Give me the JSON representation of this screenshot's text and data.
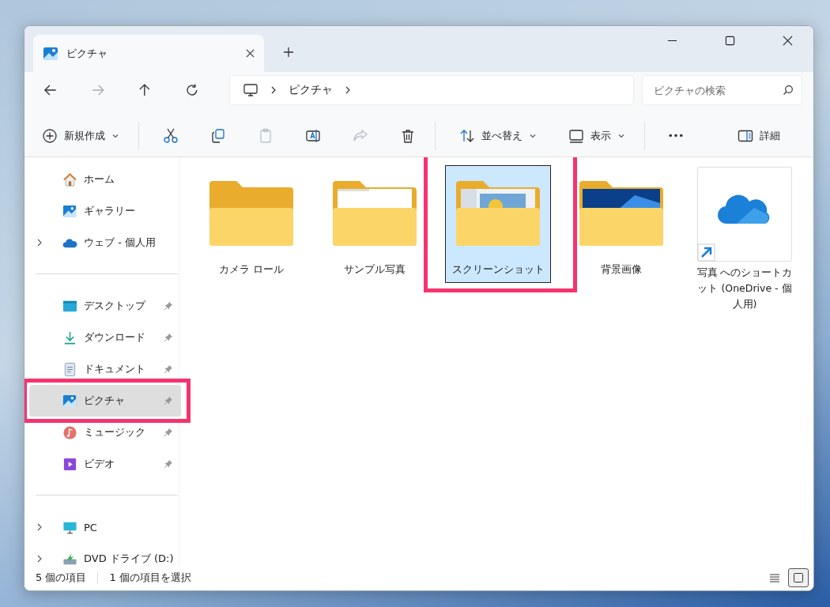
{
  "tab": {
    "title": "ピクチャ",
    "selected": true
  },
  "address": {
    "path": [
      "ピクチャ"
    ]
  },
  "search": {
    "placeholder": "ピクチャの検索"
  },
  "toolbar": [
    {
      "kind": "new",
      "label": "新規作成",
      "dropdown": true,
      "disabled": false
    },
    {
      "kind": "separator"
    },
    {
      "kind": "cut",
      "disabled": false
    },
    {
      "kind": "copy",
      "disabled": false
    },
    {
      "kind": "paste",
      "disabled": true
    },
    {
      "kind": "rename",
      "disabled": false
    },
    {
      "kind": "share",
      "disabled": true
    },
    {
      "kind": "delete",
      "disabled": false
    },
    {
      "kind": "separator"
    },
    {
      "kind": "sort",
      "label": "並べ替え",
      "dropdown": true,
      "disabled": false
    },
    {
      "kind": "view",
      "label": "表示",
      "dropdown": true,
      "disabled": false
    },
    {
      "kind": "separator"
    },
    {
      "kind": "more",
      "disabled": false
    },
    {
      "kind": "spacer"
    },
    {
      "kind": "details",
      "label": "詳細",
      "disabled": false
    }
  ],
  "sidebar": {
    "groups": [
      [
        {
          "label": "ホーム",
          "expandable": false,
          "pinned": false,
          "selected": false,
          "highlighted": false
        },
        {
          "label": "ギャラリー",
          "expandable": false,
          "pinned": false,
          "selected": false,
          "highlighted": false
        },
        {
          "label": "ウェブ - 個人用",
          "expandable": true,
          "pinned": false,
          "selected": false,
          "highlighted": false
        }
      ],
      [
        {
          "label": "デスクトップ",
          "expandable": false,
          "pinned": true,
          "selected": false,
          "highlighted": false
        },
        {
          "label": "ダウンロード",
          "expandable": false,
          "pinned": true,
          "selected": false,
          "highlighted": false
        },
        {
          "label": "ドキュメント",
          "expandable": false,
          "pinned": true,
          "selected": false,
          "highlighted": false
        },
        {
          "label": "ピクチャ",
          "expandable": false,
          "pinned": true,
          "selected": true,
          "highlighted": true
        },
        {
          "label": "ミュージック",
          "expandable": false,
          "pinned": true,
          "selected": false,
          "highlighted": false
        },
        {
          "label": "ビデオ",
          "expandable": false,
          "pinned": true,
          "selected": false,
          "highlighted": false
        }
      ],
      [
        {
          "label": "PC",
          "expandable": true,
          "pinned": false,
          "selected": false,
          "highlighted": false
        },
        {
          "label": "DVD ドライブ (D:)",
          "expandable": true,
          "pinned": false,
          "selected": false,
          "highlighted": false
        }
      ]
    ]
  },
  "files": [
    {
      "name": "カメラ ロール",
      "kind": "folder",
      "selected": false,
      "highlighted": false
    },
    {
      "name": "サンプル写真",
      "kind": "folder",
      "selected": false,
      "highlighted": false
    },
    {
      "name": "スクリーンショット",
      "kind": "folder",
      "selected": true,
      "highlighted": true
    },
    {
      "name": "背景画像",
      "kind": "folder",
      "selected": false,
      "highlighted": false
    },
    {
      "name": "写真 へのショートカット (OneDrive - 個人用)",
      "kind": "shortcut",
      "selected": false,
      "highlighted": false
    }
  ],
  "status_bar": {
    "count": "5 個の項目",
    "selection": "1 個の項目を選択",
    "views": [
      {
        "kind": "details",
        "selected": false
      },
      {
        "kind": "tiles",
        "selected": true
      }
    ]
  }
}
